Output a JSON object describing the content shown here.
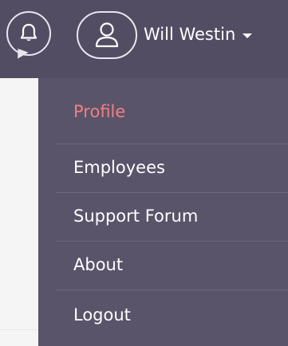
{
  "header": {
    "notifications_icon": "bell-icon",
    "user_icon": "user-icon",
    "user_name": "Will Westin",
    "caret_icon": "caret-down-icon"
  },
  "colors": {
    "header_bg": "#534d64",
    "menu_bg": "#5a546a",
    "active_item": "#f08080",
    "text": "#ffffff"
  },
  "menu": {
    "items": [
      {
        "label": "Profile",
        "active": true
      },
      {
        "label": "Employees",
        "active": false
      },
      {
        "label": "Support Forum",
        "active": false
      },
      {
        "label": "About",
        "active": false
      },
      {
        "label": "Logout",
        "active": false
      }
    ]
  }
}
